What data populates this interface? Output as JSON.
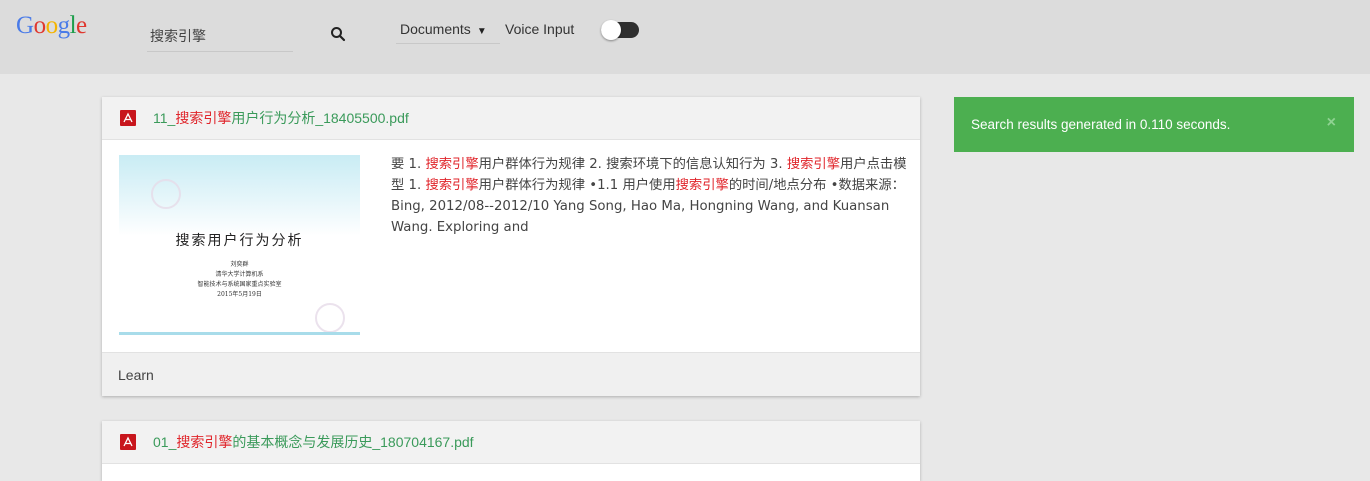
{
  "header": {
    "logo_letters": [
      {
        "ch": "G",
        "color": "#4a7be8"
      },
      {
        "ch": "o",
        "color": "#e0382f"
      },
      {
        "ch": "o",
        "color": "#f4b400"
      },
      {
        "ch": "g",
        "color": "#4a7be8"
      },
      {
        "ch": "l",
        "color": "#1e9e4b"
      },
      {
        "ch": "e",
        "color": "#e0382f"
      }
    ],
    "search_value": "搜索引擎",
    "search_icon": "search-icon",
    "filter_selected": "Documents",
    "voice_label": "Voice Input",
    "voice_enabled": false
  },
  "results": [
    {
      "title_prefix": "11_",
      "title_hl": "搜索引擎",
      "title_rest": "用户行为分析_18405500.pdf",
      "thumbnail": {
        "title": "搜索用户行为分析",
        "lines": [
          "刘奕群",
          "清华大学计算机系",
          "智能技术与系统国家重点实验室",
          "2015年5月19日"
        ]
      },
      "snippet": [
        {
          "t": "要 1. ",
          "hl": false
        },
        {
          "t": "搜索引擎",
          "hl": true
        },
        {
          "t": "用户群体行为规律 2. 搜索环境下的信息认知行为 3. ",
          "hl": false
        },
        {
          "t": "搜索引擎",
          "hl": true
        },
        {
          "t": "用户点击模型 1. ",
          "hl": false
        },
        {
          "t": "搜索引擎",
          "hl": true
        },
        {
          "t": "用户群体行为规律 •1.1 用户使用",
          "hl": false
        },
        {
          "t": "搜索引擎",
          "hl": true
        },
        {
          "t": "的时间/地点分布 •数据来源：Bing, 2012/08--2012/10 Yang Song, Hao Ma, Hongning Wang, and Kuansan Wang. Exploring and",
          "hl": false
        }
      ],
      "tag": "Learn"
    },
    {
      "title_prefix": "01_",
      "title_hl": "搜索引擎",
      "title_rest": "的基本概念与发展历史_180704167.pdf"
    }
  ],
  "toast": {
    "message": "Search results generated in 0.110 seconds.",
    "close_glyph": "×",
    "color": "#4caf50"
  }
}
